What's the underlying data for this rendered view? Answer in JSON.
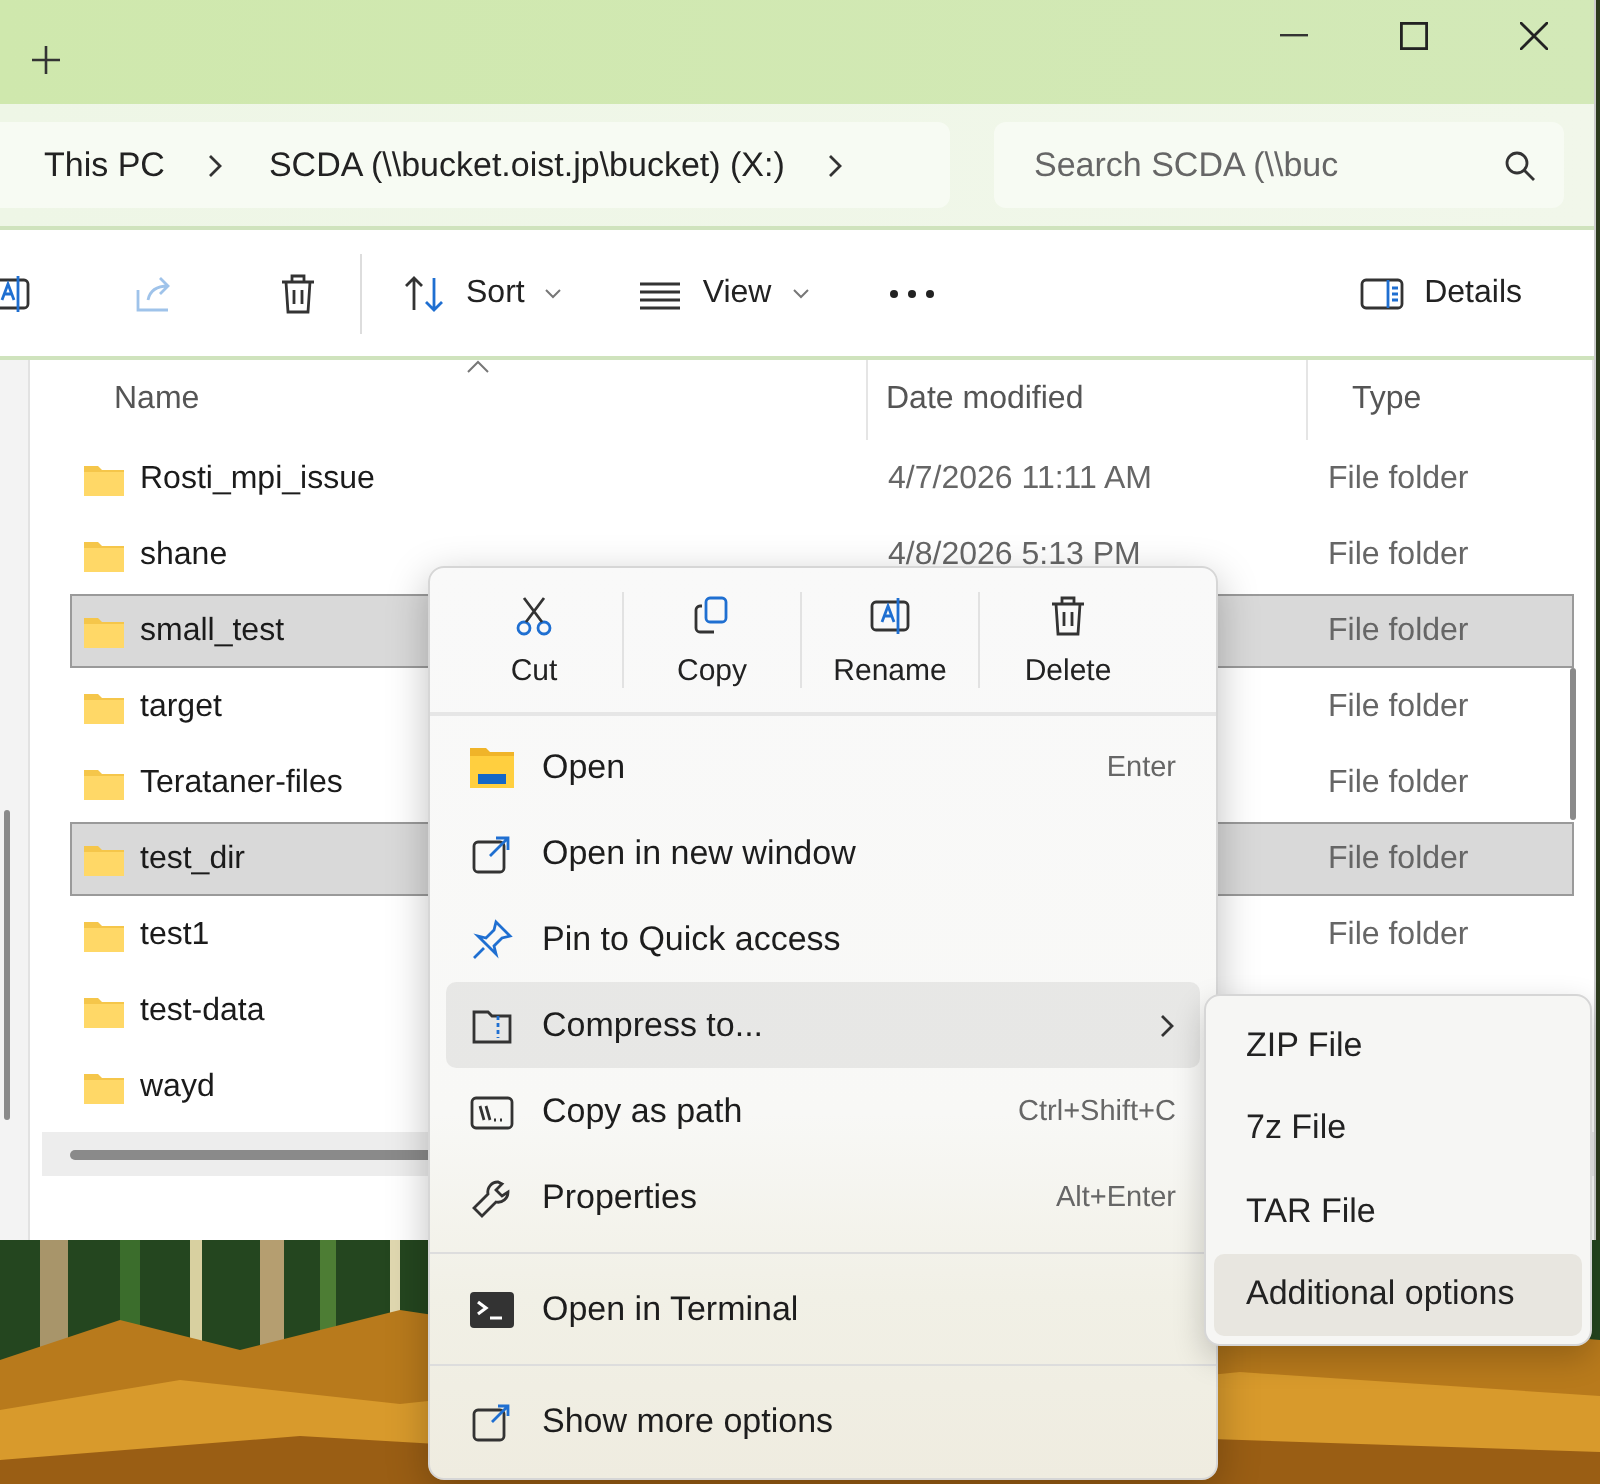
{
  "address": {
    "crumbs": [
      "This PC",
      "SCDA (\\\\bucket.oist.jp\\bucket) (X:)"
    ]
  },
  "search": {
    "placeholder": "Search SCDA (\\\\buc"
  },
  "toolbar": {
    "sort": "Sort",
    "view": "View",
    "details": "Details"
  },
  "columns": [
    "Name",
    "Date modified",
    "Type"
  ],
  "rows": [
    {
      "name": "Rosti_mpi_issue",
      "date": "4/7/2026 11:11 AM",
      "type": "File folder",
      "selected": false
    },
    {
      "name": "shane",
      "date": "4/8/2026 5:13 PM",
      "type": "File folder",
      "selected": false
    },
    {
      "name": "small_test",
      "type": "File folder",
      "selected": true
    },
    {
      "name": "target",
      "type": "File folder",
      "selected": false
    },
    {
      "name": "Terataner-files",
      "type": "File folder",
      "selected": false
    },
    {
      "name": "test_dir",
      "type": "File folder",
      "selected": true
    },
    {
      "name": "test1",
      "type": "File folder",
      "selected": false
    },
    {
      "name": "test-data",
      "selected": false
    },
    {
      "name": "wayd",
      "selected": false
    }
  ],
  "context_menu": {
    "actions": [
      "Cut",
      "Copy",
      "Rename",
      "Delete"
    ],
    "items": [
      {
        "kind": "item",
        "label": "Open",
        "shortcut": "Enter",
        "selected": false
      },
      {
        "kind": "item",
        "label": "Open in new window",
        "selected": false
      },
      {
        "kind": "item",
        "label": "Pin to Quick access",
        "selected": false
      },
      {
        "kind": "submenu",
        "label": "Compress to...",
        "selected": true
      },
      {
        "kind": "item",
        "label": "Copy as path",
        "shortcut": "Ctrl+Shift+C",
        "selected": false
      },
      {
        "kind": "item",
        "label": "Properties",
        "shortcut": "Alt+Enter",
        "selected": false
      },
      {
        "kind": "separator"
      },
      {
        "kind": "item",
        "label": "Open in Terminal",
        "selected": false
      },
      {
        "kind": "separator"
      },
      {
        "kind": "item",
        "label": "Show more options",
        "selected": false
      }
    ]
  },
  "submenu": {
    "items": [
      {
        "label": "ZIP File",
        "selected": false
      },
      {
        "label": "7z File",
        "selected": false
      },
      {
        "label": "TAR File",
        "selected": false
      },
      {
        "label": "Additional options",
        "selected": true
      }
    ]
  }
}
